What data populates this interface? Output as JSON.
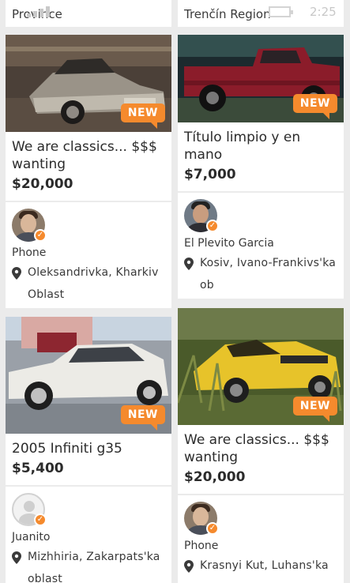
{
  "status": {
    "time": "2:25"
  },
  "top_cards": [
    {
      "text": "Province"
    },
    {
      "text": "Trenčín Region"
    }
  ],
  "listings": [
    {
      "title": "We are classics... $$$ wanting",
      "price": "$20,000",
      "badge": "NEW",
      "seller": {
        "name": "Phone",
        "location": "Oleksandrivka, Kharkiv Oblast",
        "verified": true
      },
      "photo": "silver-classic-bmw"
    },
    {
      "title": "Título limpio y en mano",
      "price": "$7,000",
      "badge": "NEW",
      "seller": {
        "name": "El Plevito Garcia",
        "location": "Kosiv, Ivano-Frankivs'ka ob",
        "verified": true
      },
      "photo": "red-pickup-truck"
    },
    {
      "title": "2005 Infiniti g35",
      "price": "$5,400",
      "badge": "NEW",
      "seller": {
        "name": "Juanito",
        "location": "Mizhhiria, Zakarpats'ka oblast",
        "verified": true
      },
      "photo": "white-sedan"
    },
    {
      "title": "We are classics... $$$ wanting",
      "price": "$20,000",
      "badge": "NEW",
      "seller": {
        "name": "Phone",
        "location": "Krasnyi Kut, Luhans'ka",
        "verified": true
      },
      "photo": "yellow-muscle-car"
    }
  ],
  "colors": {
    "accent": "#f58a2d",
    "background": "#ebebeb",
    "card": "#ffffff"
  },
  "icons": {
    "location": "map-pin-icon",
    "verified": "check-badge-icon",
    "signal": "signal-icon",
    "battery": "battery-icon"
  }
}
